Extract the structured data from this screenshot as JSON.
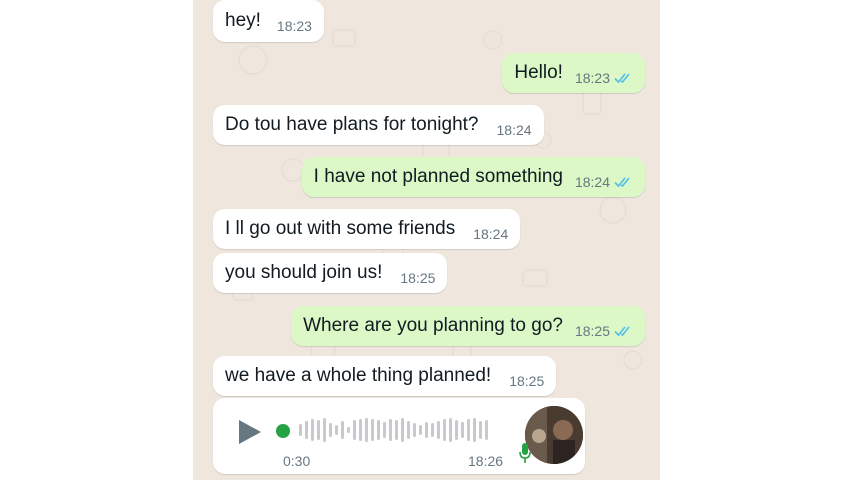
{
  "colors": {
    "incoming_bg": "#ffffff",
    "outgoing_bg": "#dcf8c6",
    "chat_bg": "#efe7de",
    "read_ticks": "#53bdeb",
    "voice_dot": "#25a244"
  },
  "messages": [
    {
      "direction": "in",
      "text": "hey!",
      "time": "18:23"
    },
    {
      "direction": "out",
      "text": "Hello!",
      "time": "18:23",
      "status": "read"
    },
    {
      "direction": "in",
      "text": "Do tou have plans for tonight?",
      "time": "18:24"
    },
    {
      "direction": "out",
      "text": "I have not planned something",
      "time": "18:24",
      "status": "read"
    },
    {
      "direction": "in",
      "text": "I ll go out with some friends",
      "time": "18:24"
    },
    {
      "direction": "in",
      "text": "you should join us!",
      "time": "18:25"
    },
    {
      "direction": "out",
      "text": "Where are you planning to go?",
      "time": "18:25",
      "status": "read"
    },
    {
      "direction": "in",
      "text": "we have a whole thing planned!",
      "time": "18:25"
    }
  ],
  "voice_message": {
    "duration": "0:30",
    "time": "18:26",
    "play_icon": "play-icon",
    "mic_icon": "mic-icon"
  }
}
